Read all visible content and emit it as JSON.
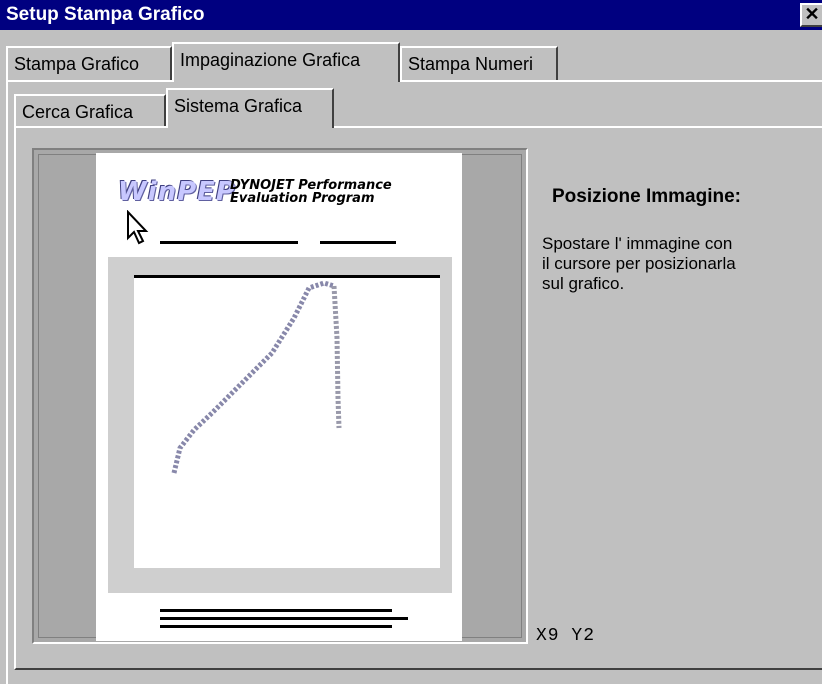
{
  "window": {
    "title": "Setup Stampa Grafico",
    "close_symbol": "✕"
  },
  "outer_tabs": [
    {
      "label": "Stampa Grafico",
      "active": false
    },
    {
      "label": "Impaginazione Grafica",
      "active": true
    },
    {
      "label": "Stampa Numeri",
      "active": false
    }
  ],
  "inner_tabs": [
    {
      "label": "Cerca Grafica",
      "active": false
    },
    {
      "label": "Sistema Grafica",
      "active": true
    }
  ],
  "preview": {
    "logo": "WinPEP",
    "logo_caption_line1": "DYNOJET Performance",
    "logo_caption_line2": "Evaluation Program"
  },
  "info": {
    "title": "Posizione Immagine:",
    "description": "Spostare l' immagine con il cursore per posizionarla sul grafico."
  },
  "coords": {
    "x_label": "X9",
    "y_label": "Y2"
  },
  "icons": {
    "close": "close-icon",
    "cursor": "mouse-pointer-icon"
  }
}
